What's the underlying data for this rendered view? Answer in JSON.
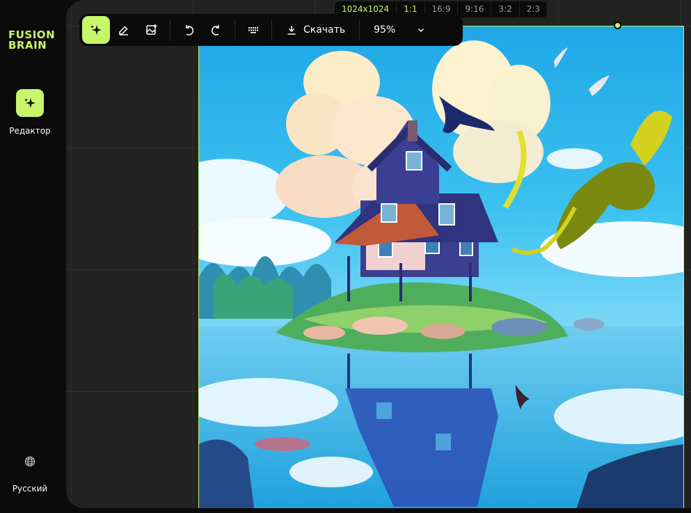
{
  "app": {
    "logo_line1": "FUSION",
    "logo_line2": "BRAIN",
    "accent": "#c8f56a"
  },
  "sidebar": {
    "editor_label": "Редактор",
    "editor_icon": "sparkle-icon",
    "language_label": "Русский",
    "language_icon": "globe-icon"
  },
  "toolbar": {
    "tools": [
      {
        "icon": "sparkle-icon",
        "active": true
      },
      {
        "icon": "eraser-icon",
        "active": false
      },
      {
        "icon": "image-add-icon",
        "active": false
      },
      {
        "icon": "undo-icon",
        "active": false
      },
      {
        "icon": "redo-icon",
        "active": false
      },
      {
        "icon": "keyboard-icon",
        "active": false
      }
    ],
    "download_label": "Скачать",
    "download_icon": "download-icon",
    "zoom": "95%",
    "zoom_icon": "chevron-down-icon"
  },
  "ratios": {
    "size": "1024x1024",
    "options": [
      "1:1",
      "16:9",
      "9:16",
      "3:2",
      "2:3"
    ],
    "selected": "1:1"
  },
  "canvas": {
    "image_subject": "house-on-island-illustration"
  }
}
